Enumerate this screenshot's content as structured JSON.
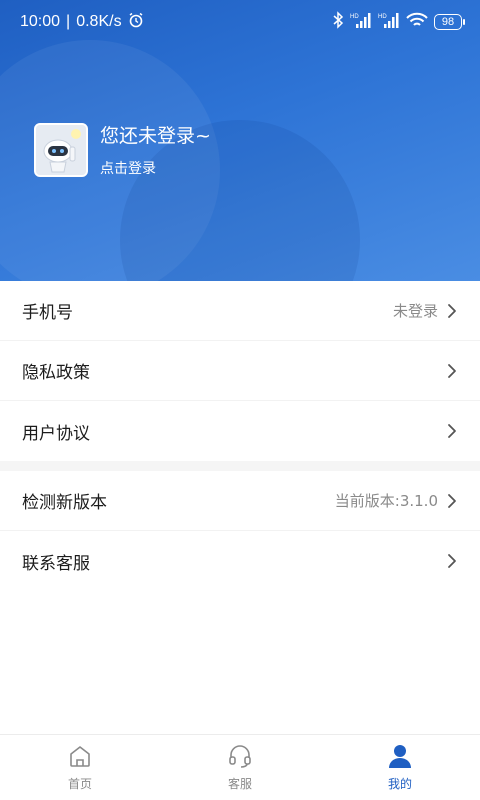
{
  "status": {
    "time": "10:00",
    "speed": "0.8K/s",
    "battery": "98",
    "icons": [
      "alarm-icon",
      "bluetooth-icon",
      "signal-hd-icon",
      "signal-hd-icon",
      "wifi-icon",
      "battery-icon"
    ]
  },
  "profile": {
    "title": "您还未登录~",
    "subtitle": "点击登录",
    "avatar_icon": "robot-avatar-icon"
  },
  "menu": [
    {
      "label": "手机号",
      "value": "未登录"
    },
    {
      "label": "隐私政策",
      "value": ""
    },
    {
      "label": "用户协议",
      "value": ""
    },
    {
      "label": "检测新版本",
      "value": "当前版本:3.1.0"
    },
    {
      "label": "联系客服",
      "value": ""
    }
  ],
  "tabs": [
    {
      "label": "首页",
      "icon": "home-icon"
    },
    {
      "label": "客服",
      "icon": "headset-icon"
    },
    {
      "label": "我的",
      "icon": "user-icon"
    }
  ],
  "colors": {
    "primary": "#1f5fc2",
    "header_light": "#4a8de3",
    "text": "#1c1c1c",
    "muted": "#8a8a8a"
  }
}
